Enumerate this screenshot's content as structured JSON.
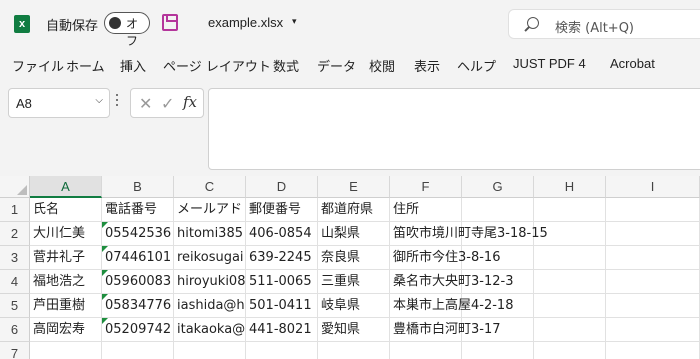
{
  "titlebar": {
    "logo_letter": "x",
    "autosave_label": "自動保存",
    "toggle_state": "オフ",
    "filename": "example.xlsx",
    "filename_caret": "▾",
    "search_placeholder": "検索 (Alt+Q)"
  },
  "ribbon": {
    "tabs": [
      "ファイル",
      "ホーム",
      "挿入",
      "ページ レイアウト",
      "数式",
      "データ",
      "校閲",
      "表示",
      "ヘルプ",
      "JUST PDF 4",
      "Acrobat"
    ]
  },
  "formula_bar": {
    "name_box": "A8",
    "cancel_glyph": "✕",
    "enter_glyph": "✓",
    "fx_label": "fx",
    "formula": ""
  },
  "sheet": {
    "columns": [
      "A",
      "B",
      "C",
      "D",
      "E",
      "F",
      "G",
      "H",
      "I"
    ],
    "rows": [
      "1",
      "2",
      "3",
      "4",
      "5",
      "6",
      "7"
    ],
    "selected_column": "A",
    "data": [
      [
        "氏名",
        "電話番号",
        "メールアド",
        "郵便番号",
        "都道府県",
        "住所"
      ],
      [
        "大川仁美",
        "05542536",
        "hitomi385",
        "406-0854",
        "山梨県",
        "笛吹市境川町寺尾3-18-15"
      ],
      [
        "菅井礼子",
        "07446101",
        "reikosugai",
        "639-2245",
        "奈良県",
        "御所市今住3-8-16"
      ],
      [
        "福地浩之",
        "05960083",
        "hiroyuki08",
        "511-0065",
        "三重県",
        "桑名市大央町3-12-3"
      ],
      [
        "芦田重樹",
        "05834776",
        "iashida@h",
        "501-0411",
        "岐阜県",
        "本巣市上高屋4-2-18"
      ],
      [
        "高岡宏寿",
        "05209742",
        "itakaoka@",
        "441-8021",
        "愛知県",
        "豊橋市白河町3-17"
      ],
      [
        "",
        "",
        "",
        "",
        "",
        ""
      ]
    ]
  }
}
